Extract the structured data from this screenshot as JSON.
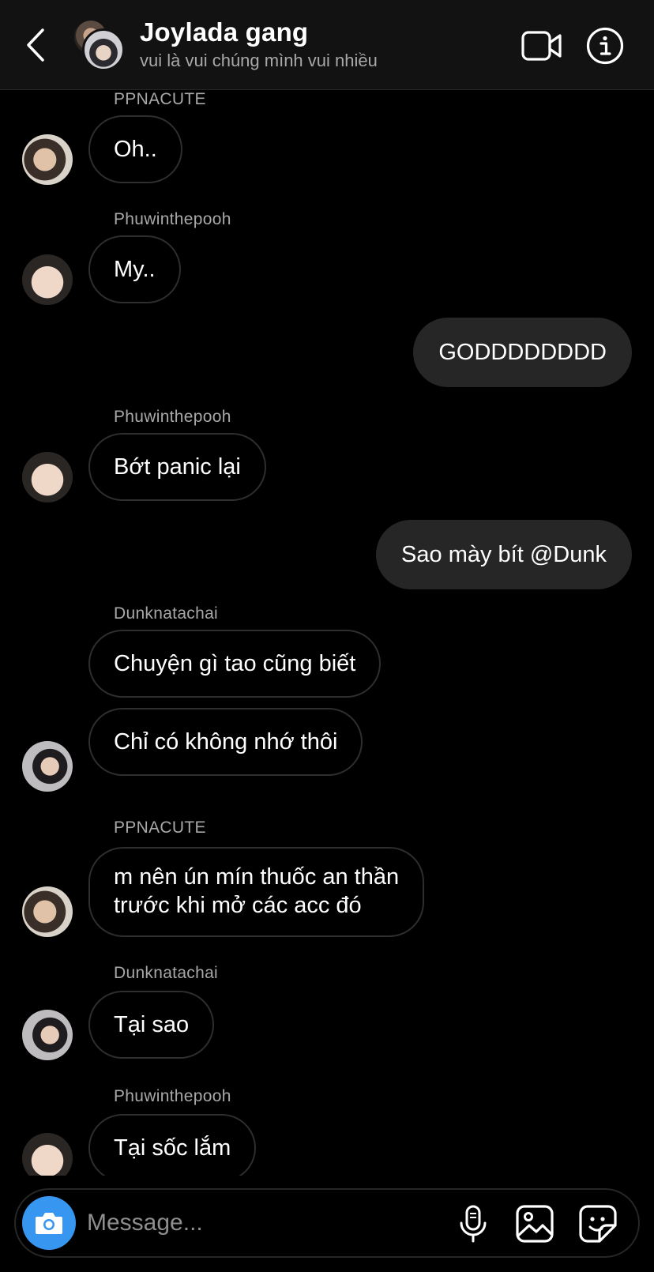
{
  "header": {
    "title": "Joylada gang",
    "subtitle": "vui là vui chúng mình vui nhiều"
  },
  "messages": [
    {
      "type": "sender",
      "text": "PPNACUTE"
    },
    {
      "type": "in",
      "text": "Oh.."
    },
    {
      "type": "sender",
      "text": "Phuwinthepooh"
    },
    {
      "type": "in",
      "text": "My.."
    },
    {
      "type": "out",
      "text": "GODDDDDDDD"
    },
    {
      "type": "sender",
      "text": "Phuwinthepooh"
    },
    {
      "type": "in",
      "text": "Bớt panic lại"
    },
    {
      "type": "out",
      "text": "Sao mày bít @Dunk"
    },
    {
      "type": "sender",
      "text": "Dunknatachai"
    },
    {
      "type": "in",
      "text": "Chuyện gì tao cũng biết"
    },
    {
      "type": "in",
      "text": "Chỉ có không nhớ thôi"
    },
    {
      "type": "sender",
      "text": "PPNACUTE"
    },
    {
      "type": "in",
      "lines": [
        "m nên ún mín thuốc an thần",
        "trước khi mở các acc đó"
      ]
    },
    {
      "type": "sender",
      "text": "Dunknatachai"
    },
    {
      "type": "in",
      "text": "Tại sao"
    },
    {
      "type": "sender",
      "text": "Phuwinthepooh"
    },
    {
      "type": "in",
      "text": "Tại sốc lắm"
    }
  ],
  "composer": {
    "placeholder": "Message..."
  },
  "icons": {
    "back": "chevron-left-icon",
    "video": "video-call-icon",
    "info": "info-icon",
    "camera": "camera-icon",
    "mic": "microphone-icon",
    "gallery": "gallery-icon",
    "sticker": "sticker-icon"
  },
  "colors": {
    "background": "#000000",
    "header": "#121212",
    "outgoing_bubble": "#262626",
    "incoming_border": "#2e2e2e",
    "camera_button": "#3797f0",
    "secondary_text": "#a8a8a8"
  }
}
